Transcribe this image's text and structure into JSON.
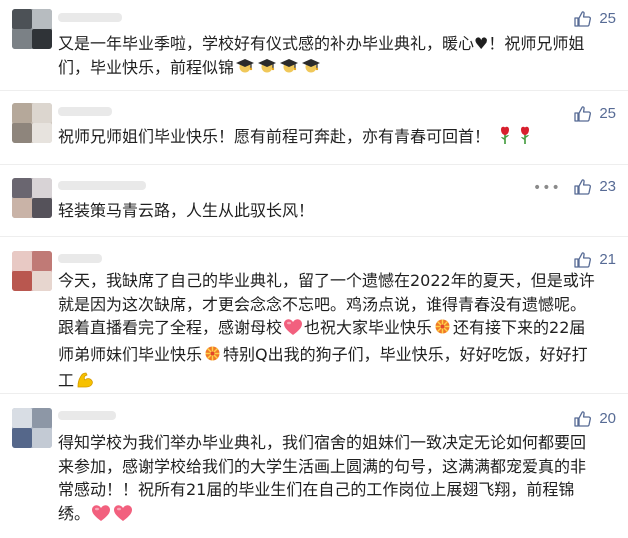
{
  "comments": [
    {
      "likes": "25",
      "text_lines": [
        "又是一年毕业季啦，学校好有仪式感的补办毕业典礼，暖心♥！祝师兄师姐",
        "们，毕业快乐，前程似锦"
      ]
    },
    {
      "likes": "25",
      "text_lines": [
        "祝师兄师姐们毕业快乐！愿有前程可奔赴，亦有青春可回首！"
      ]
    },
    {
      "likes": "23",
      "text_lines": [
        "轻装策马青云路，人生从此驭长风！"
      ]
    },
    {
      "likes": "21",
      "text_lines": [
        "今天，我缺席了自己的毕业典礼，留了一个遗憾在2022年的夏天，但是或许",
        "就是因为这次缺席，才更会念念不忘吧。鸡汤点说，谁得青春没有遗憾呢。",
        [
          "跟着直播看完了全程，感谢母校",
          "也祝大家毕业快乐",
          "还有接下来的22届"
        ],
        [
          "师弟师妹们毕业快乐",
          "特别Q出我的狗子们，毕业快乐，好好吃饭，好好打"
        ],
        "工"
      ]
    },
    {
      "likes": "20",
      "text_lines": [
        "得知学校为我们举办毕业典礼，我们宿舍的姐妹们一致决定无论如何都要回",
        "来参加，感谢学校给我们的大学生活画上圆满的句号，这满满都宠爱真的非",
        "常感动！！祝所有21届的毕业生们在自己的工作岗位上展翅飞翔，前程锦",
        "绣。"
      ]
    }
  ],
  "icons": {
    "like": "thumbs-up-icon",
    "more": "more-dots-icon",
    "emoji_graduation": "graduation-cap-icon",
    "emoji_rose": "rose-icon",
    "emoji_heart": "heart-icon",
    "emoji_celebrate": "celebration-icon",
    "emoji_muscle": "flexed-biceps-icon"
  },
  "colors": {
    "like_blue": "#576b95",
    "text": "#1f1f1f",
    "heart": "#f2607e",
    "rose": "#d8202e",
    "celebrate": "#f07a28",
    "muscle": "#f6c100"
  }
}
